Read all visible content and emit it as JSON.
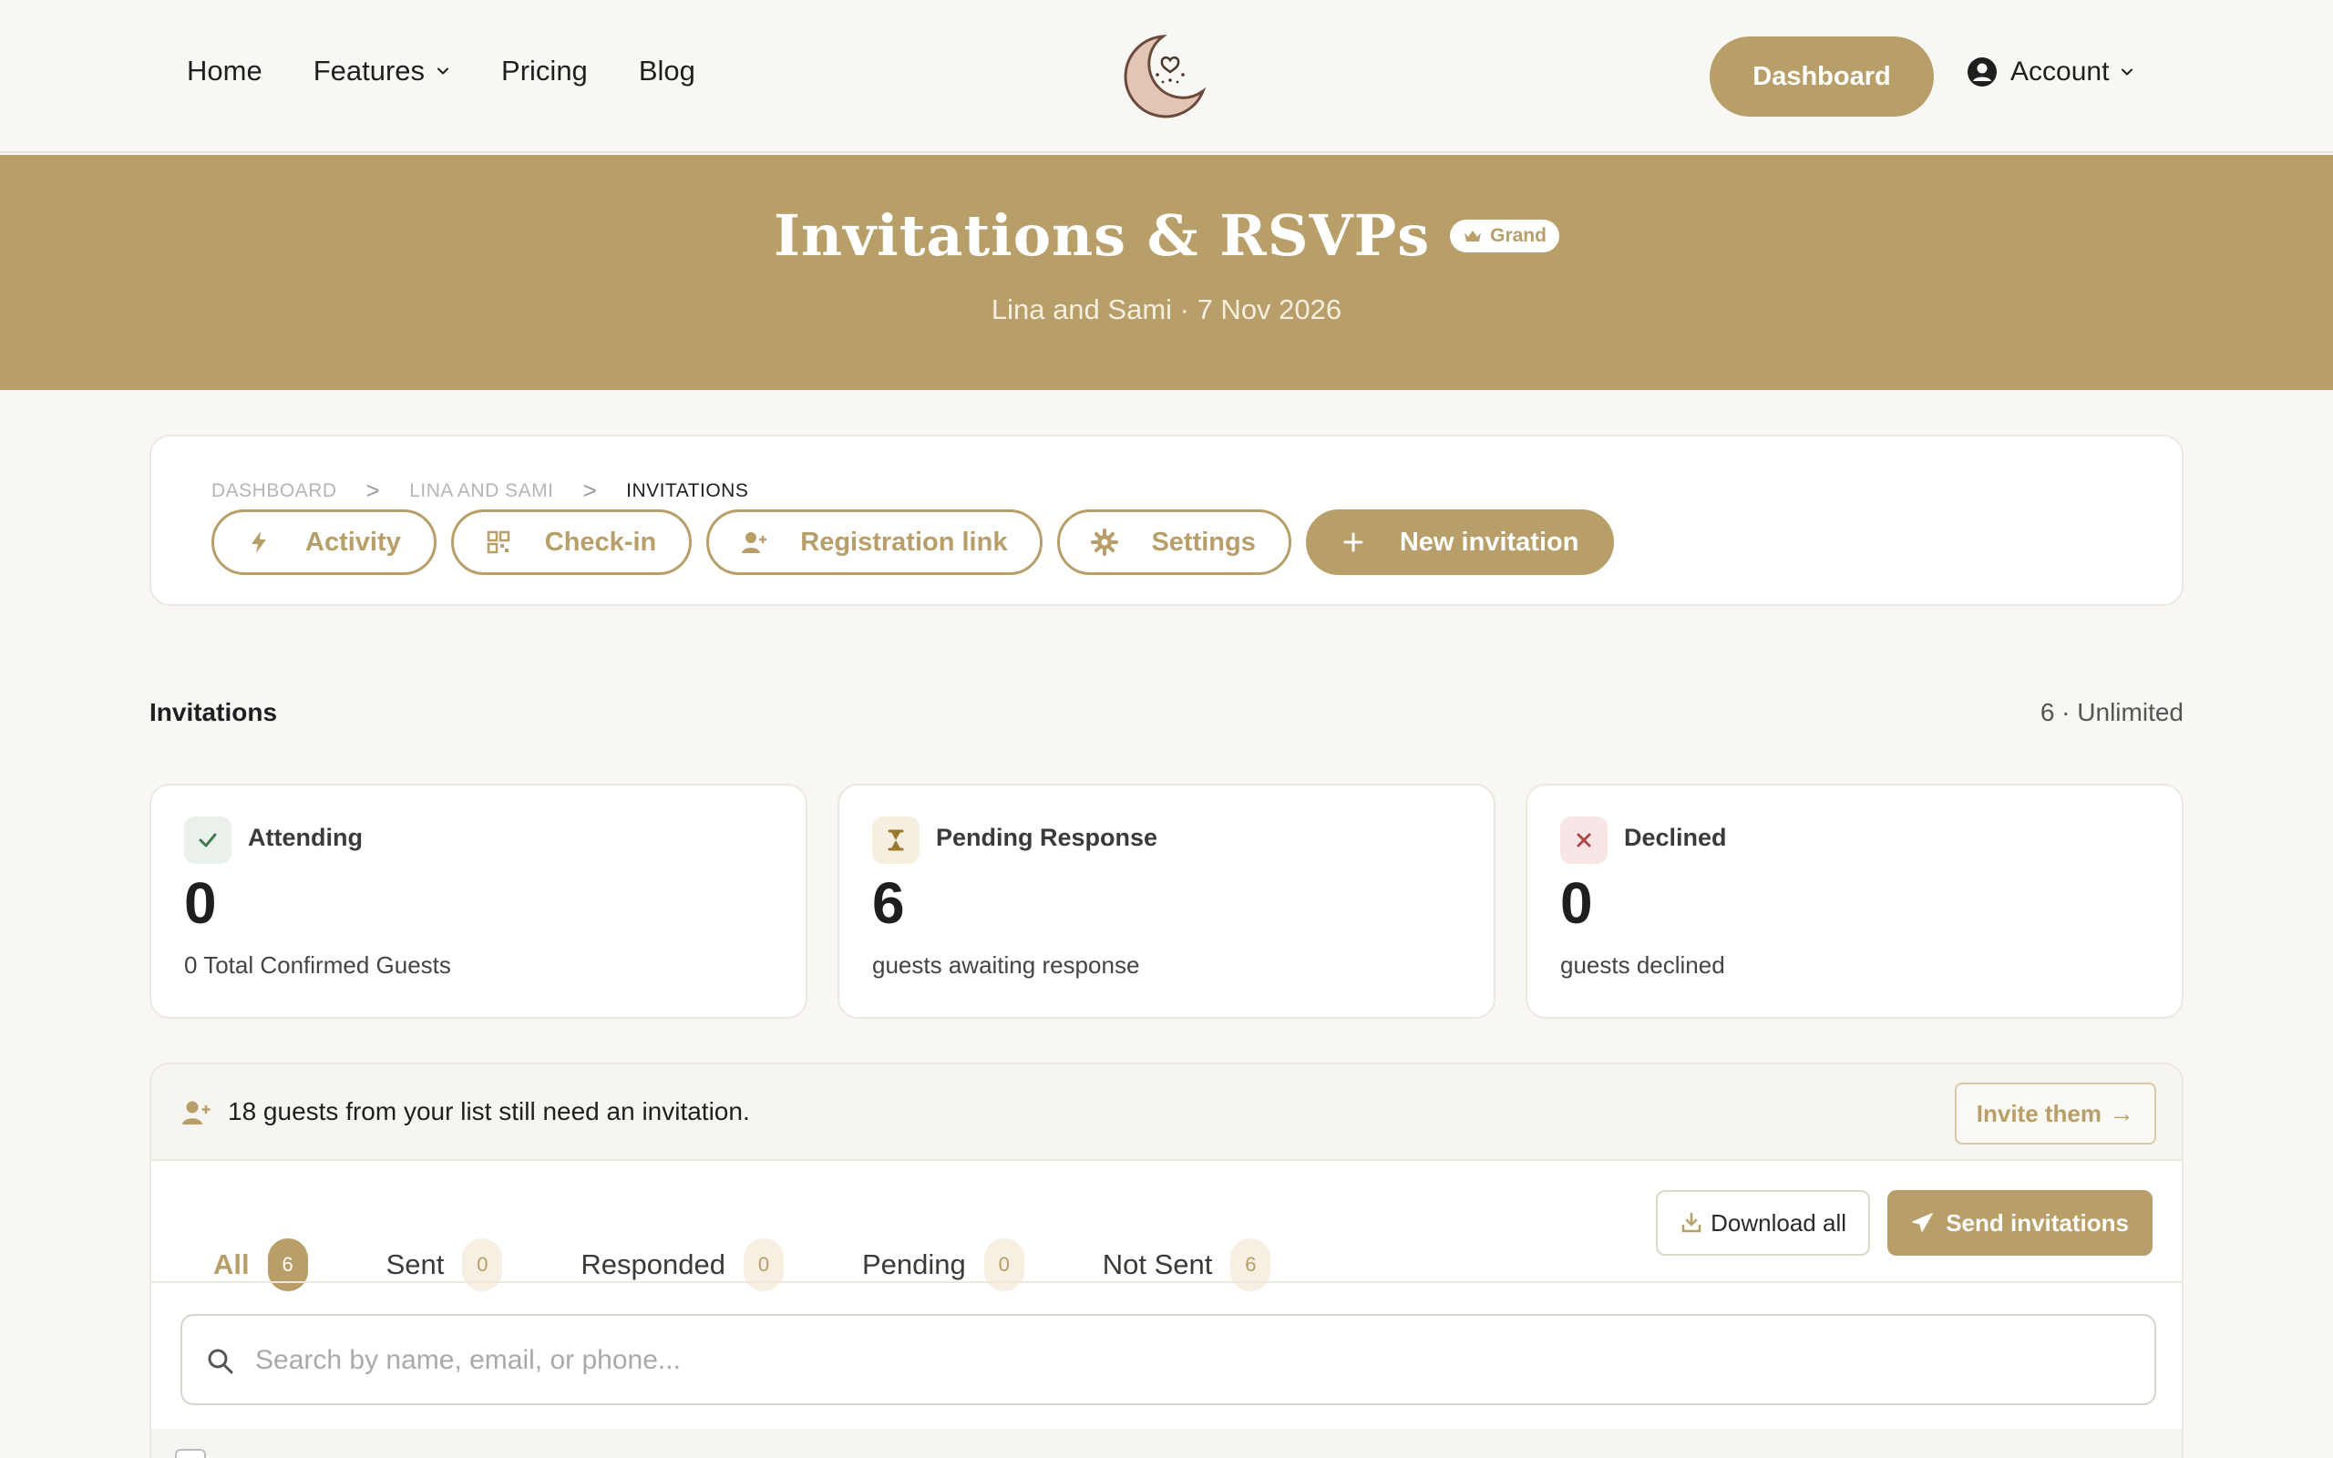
{
  "nav": {
    "links": [
      {
        "label": "Home"
      },
      {
        "label": "Features"
      },
      {
        "label": "Pricing"
      },
      {
        "label": "Blog"
      }
    ],
    "dashboard_label": "Dashboard",
    "account_label": "Account"
  },
  "banner": {
    "title": "Invitations & RSVPs",
    "badge": "Grand",
    "subtitle": "Lina and Sami · 7 Nov 2026"
  },
  "breadcrumb": [
    "DASHBOARD",
    "LINA AND SAMI",
    "INVITATIONS"
  ],
  "breadcrumb_sep": ">",
  "actions": {
    "activity": "Activity",
    "checkin": "Check-in",
    "registration": "Registration link",
    "settings": "Settings",
    "new_invitation": "New invitation"
  },
  "invitations": {
    "title": "Invitations",
    "count": "6 · Unlimited"
  },
  "stats": [
    {
      "label": "Attending",
      "value": "0",
      "desc": "0 Total Confirmed Guests",
      "icon": "check-icon"
    },
    {
      "label": "Pending Response",
      "value": "6",
      "desc": "guests awaiting response",
      "icon": "hourglass-icon"
    },
    {
      "label": "Declined",
      "value": "0",
      "desc": "guests declined",
      "icon": "x-icon"
    }
  ],
  "notice": {
    "text": "18 guests from your list still need an invitation.",
    "button": "Invite them",
    "arrow": "→"
  },
  "tabs": [
    {
      "label": "All",
      "count": "6"
    },
    {
      "label": "Sent",
      "count": "0"
    },
    {
      "label": "Responded",
      "count": "0"
    },
    {
      "label": "Pending",
      "count": "0"
    },
    {
      "label": "Not Sent",
      "count": "6"
    }
  ],
  "buttons": {
    "download_all": "Download all",
    "send_invitations": "Send invitations"
  },
  "search": {
    "placeholder": "Search by name, email, or phone..."
  },
  "colors": {
    "brand": "#b89e68",
    "background": "#f8f7f3",
    "attending_bg": "#e9f1ea",
    "pending_bg": "#f6efe0",
    "declined_bg": "#f8e6e6"
  }
}
